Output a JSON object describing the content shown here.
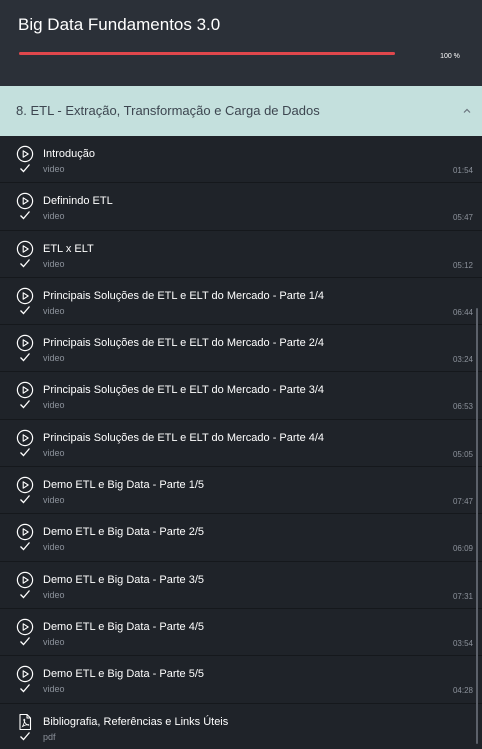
{
  "header": {
    "course_title": "Big Data Fundamentos 3.0",
    "progress_percent": 100,
    "progress_label": "100 %"
  },
  "colors": {
    "progress_fill": "#e0474c",
    "section_bg": "#c4e0dd",
    "panel_bg": "#1f2329"
  },
  "section": {
    "title": "8. ETL - Extração, Transformação e Carga de Dados",
    "expanded": true,
    "toggle_icon": "chevron-up-icon"
  },
  "lessons": [
    {
      "title": "Introdução",
      "type": "video",
      "duration": "01:54",
      "completed": true,
      "icon": "play-circle-icon"
    },
    {
      "title": "Definindo ETL",
      "type": "video",
      "duration": "05:47",
      "completed": true,
      "icon": "play-circle-icon"
    },
    {
      "title": "ETL x ELT",
      "type": "video",
      "duration": "05:12",
      "completed": true,
      "icon": "play-circle-icon"
    },
    {
      "title": "Principais Soluções de ETL e ELT do Mercado - Parte 1/4",
      "type": "video",
      "duration": "06:44",
      "completed": true,
      "icon": "play-circle-icon"
    },
    {
      "title": "Principais Soluções de ETL e ELT do Mercado - Parte 2/4",
      "type": "video",
      "duration": "03:24",
      "completed": true,
      "icon": "play-circle-icon"
    },
    {
      "title": "Principais Soluções de ETL e ELT do Mercado - Parte 3/4",
      "type": "video",
      "duration": "06:53",
      "completed": true,
      "icon": "play-circle-icon"
    },
    {
      "title": "Principais Soluções de ETL e ELT do Mercado - Parte 4/4",
      "type": "video",
      "duration": "05:05",
      "completed": true,
      "icon": "play-circle-icon"
    },
    {
      "title": "Demo ETL e Big Data - Parte 1/5",
      "type": "video",
      "duration": "07:47",
      "completed": true,
      "icon": "play-circle-icon"
    },
    {
      "title": "Demo ETL e Big Data - Parte 2/5",
      "type": "video",
      "duration": "06:09",
      "completed": true,
      "icon": "play-circle-icon"
    },
    {
      "title": "Demo ETL e Big Data - Parte 3/5",
      "type": "video",
      "duration": "07:31",
      "completed": true,
      "icon": "play-circle-icon"
    },
    {
      "title": "Demo ETL e Big Data - Parte 4/5",
      "type": "video",
      "duration": "03:54",
      "completed": true,
      "icon": "play-circle-icon"
    },
    {
      "title": "Demo ETL e Big Data - Parte 5/5",
      "type": "video",
      "duration": "04:28",
      "completed": true,
      "icon": "play-circle-icon"
    },
    {
      "title": "Bibliografia, Referências e Links Úteis",
      "type": "pdf",
      "duration": "",
      "completed": true,
      "icon": "pdf-file-icon"
    }
  ]
}
